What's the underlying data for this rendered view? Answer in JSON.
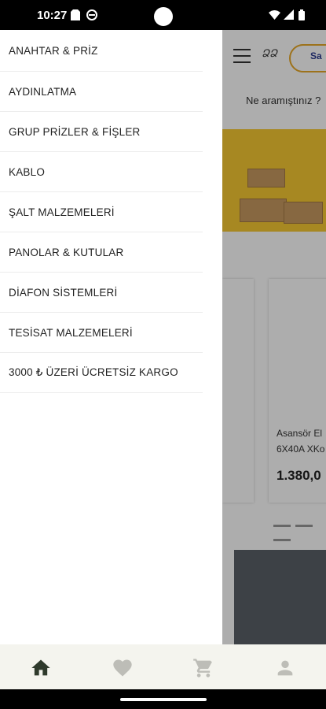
{
  "status_bar": {
    "time": "10:27"
  },
  "app": {
    "search_hint": "Ne aramıştınız ?",
    "product": {
      "name_line1": "Asansör El",
      "name_line2": "6X40A XKo",
      "price": "1.380,0"
    }
  },
  "drawer": {
    "items": [
      {
        "label": "ANAHTAR & PRİZ"
      },
      {
        "label": "AYDINLATMA"
      },
      {
        "label": "GRUP PRİZLER & FİŞLER"
      },
      {
        "label": "KABLO"
      },
      {
        "label": "ŞALT MALZEMELERİ"
      },
      {
        "label": "PANOLAR & KUTULAR"
      },
      {
        "label": "DİAFON SİSTEMLERİ"
      },
      {
        "label": "TESİSAT MALZEMELERİ"
      },
      {
        "label": "3000 ₺ ÜZERİ ÜCRETSİZ KARGO"
      }
    ]
  },
  "bottom_nav": [
    {
      "icon": "home-icon",
      "color": "#2f3a2c"
    },
    {
      "icon": "heart-icon",
      "color": "#bdbdb7"
    },
    {
      "icon": "cart-icon",
      "color": "#bdbdb7"
    },
    {
      "icon": "person-icon",
      "color": "#bdbdb7"
    }
  ]
}
